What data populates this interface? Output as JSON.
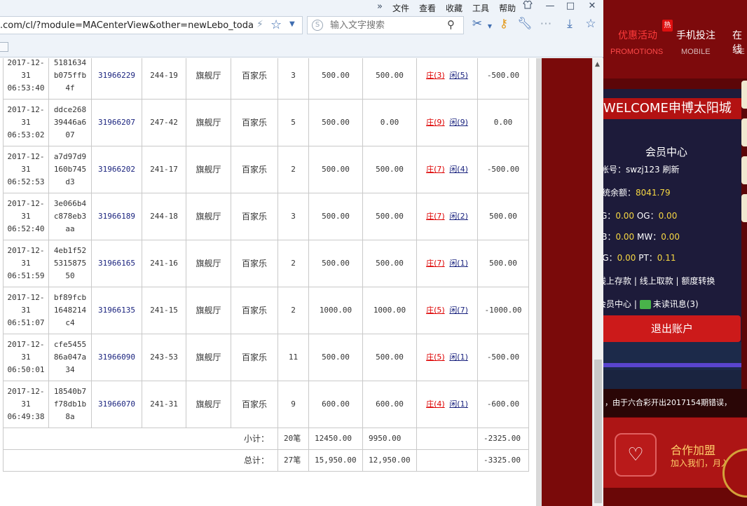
{
  "menubar": {
    "chevron": "»",
    "items": [
      "文件",
      "查看",
      "收藏",
      "工具",
      "帮助"
    ],
    "shirt_icon": "shirt-icon",
    "minimize": "—",
    "maximize": "□",
    "close": "✕"
  },
  "toolbar": {
    "url": ".com/cl/?module=MACenterView&other=newLebo_today&u",
    "search_placeholder": "输入文字搜索",
    "icons": [
      "bolt-icon",
      "star-icon",
      "dropdown-icon",
      "scissors-icon",
      "key-icon",
      "wrench-icon",
      "more-icon",
      "download-icon",
      "favorites-star-icon"
    ]
  },
  "bets": {
    "rows": [
      {
        "time": [
          "2017-12-",
          "31",
          "06:53:40"
        ],
        "id": [
          "5181634",
          "b075ffb",
          "4f"
        ],
        "no": "31966229",
        "table": "244-19",
        "hall": "旗舰厅",
        "game": "百家乐",
        "count": "3",
        "bet": "500.00",
        "valid": "500.00",
        "res_z": "庄(3)",
        "res_x": "闲(5)",
        "win": "-500.00"
      },
      {
        "time": [
          "2017-12-",
          "31",
          "06:53:02"
        ],
        "id": [
          "ddce268",
          "39446a6",
          "07"
        ],
        "no": "31966207",
        "table": "247-42",
        "hall": "旗舰厅",
        "game": "百家乐",
        "count": "5",
        "bet": "500.00",
        "valid": "0.00",
        "res_z": "庄(9)",
        "res_x": "闲(9)",
        "win": "0.00"
      },
      {
        "time": [
          "2017-12-",
          "31",
          "06:52:53"
        ],
        "id": [
          "a7d97d9",
          "160b745",
          "d3"
        ],
        "no": "31966202",
        "table": "241-17",
        "hall": "旗舰厅",
        "game": "百家乐",
        "count": "2",
        "bet": "500.00",
        "valid": "500.00",
        "res_z": "庄(7)",
        "res_x": "闲(4)",
        "win": "-500.00"
      },
      {
        "time": [
          "2017-12-",
          "31",
          "06:52:40"
        ],
        "id": [
          "3e066b4",
          "c878eb3",
          "aa"
        ],
        "no": "31966189",
        "table": "244-18",
        "hall": "旗舰厅",
        "game": "百家乐",
        "count": "3",
        "bet": "500.00",
        "valid": "500.00",
        "res_z": "庄(7)",
        "res_x": "闲(2)",
        "win": "500.00"
      },
      {
        "time": [
          "2017-12-",
          "31",
          "06:51:59"
        ],
        "id": [
          "4eb1f52",
          "5315875",
          "50"
        ],
        "no": "31966165",
        "table": "241-16",
        "hall": "旗舰厅",
        "game": "百家乐",
        "count": "2",
        "bet": "500.00",
        "valid": "500.00",
        "res_z": "庄(7)",
        "res_x": "闲(1)",
        "win": "500.00"
      },
      {
        "time": [
          "2017-12-",
          "31",
          "06:51:07"
        ],
        "id": [
          "bf89fcb",
          "1648214",
          "c4"
        ],
        "no": "31966135",
        "table": "241-15",
        "hall": "旗舰厅",
        "game": "百家乐",
        "count": "2",
        "bet": "1000.00",
        "valid": "1000.00",
        "res_z": "庄(5)",
        "res_x": "闲(7)",
        "win": "-1000.00"
      },
      {
        "time": [
          "2017-12-",
          "31",
          "06:50:01"
        ],
        "id": [
          "cfe5455",
          "86a047a",
          "34"
        ],
        "no": "31966090",
        "table": "243-53",
        "hall": "旗舰厅",
        "game": "百家乐",
        "count": "11",
        "bet": "500.00",
        "valid": "500.00",
        "res_z": "庄(5)",
        "res_x": "闲(1)",
        "win": "-500.00"
      },
      {
        "time": [
          "2017-12-",
          "31",
          "06:49:38"
        ],
        "id": [
          "18540b7",
          "f78db1b",
          "8a"
        ],
        "no": "31966070",
        "table": "241-31",
        "hall": "旗舰厅",
        "game": "百家乐",
        "count": "9",
        "bet": "600.00",
        "valid": "600.00",
        "res_z": "庄(4)",
        "res_x": "闲(1)",
        "win": "-600.00"
      }
    ],
    "subtotal": {
      "label": "小计：",
      "count": "20笔",
      "bet": "12450.00",
      "valid": "9950.00",
      "win": "-2325.00"
    },
    "total": {
      "label": "总计：",
      "count": "27笔",
      "bet": "15,950.00",
      "valid": "12,950.00",
      "win": "-3325.00"
    }
  },
  "site": {
    "nav": [
      {
        "zh": "优惠活动",
        "en": "PROMOTIONS"
      },
      {
        "zh": "手机投注",
        "en": "MOBILE"
      },
      {
        "zh": "在线",
        "en": "SE"
      }
    ],
    "hot_badge": "热",
    "welcome": "WELCOME申博太阳城",
    "member_center": "会员中心",
    "account_label": "帐号：",
    "account": "swzj123",
    "refresh": "刷新",
    "balance_label": "系统余额：",
    "balance": "8041.79",
    "wallets": [
      {
        "a_label": "AG：",
        "a": "0.00",
        "b_label": "OG：",
        "b": "0.00"
      },
      {
        "a_label": "BB：",
        "a": "0.00",
        "b_label": "MW：",
        "b": "0.00"
      },
      {
        "a_label": "MG：",
        "a": "0.00",
        "b_label": "PT：",
        "b": "0.11"
      }
    ],
    "links1": [
      "线上存款",
      "线上取款",
      "额度转换"
    ],
    "member_link": "会员中心",
    "unread": "未读讯息(3)",
    "logout": "退出账户",
    "ticker": "，由于六合彩开出2017154期错误，",
    "coop_title": "合作加盟",
    "coop_sub": "加入我们，月入百"
  }
}
